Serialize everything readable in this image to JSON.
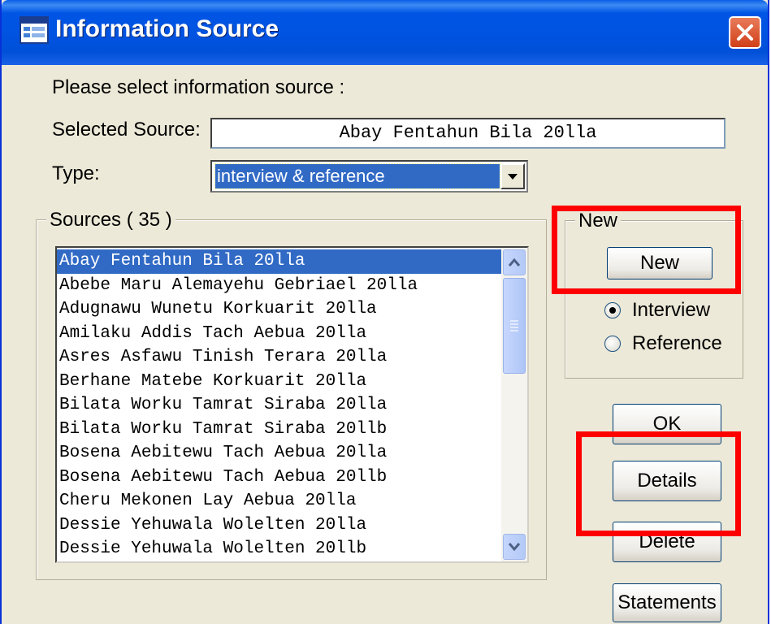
{
  "window": {
    "title": "Information Source"
  },
  "prompt": "Please select information source :",
  "selected_source": {
    "label": "Selected Source:",
    "value": "Abay Fentahun Bila 20lla"
  },
  "type": {
    "label": "Type:",
    "value": "interview & reference"
  },
  "sources": {
    "group_label": "Sources  ( 35 )",
    "items": [
      "Abay Fentahun Bila 20lla",
      "Abebe Maru Alemayehu Gebriael 20lla",
      "Adugnawu Wunetu Korkuarit 20lla",
      "Amilaku Addis Tach Aebua 20lla",
      "Asres Asfawu Tinish Terara 20lla",
      "Berhane Matebe Korkuarit 20lla",
      "Bilata Worku Tamrat Siraba 20lla",
      "Bilata Worku Tamrat Siraba 20llb",
      "Bosena Aebitewu Tach Aebua 20lla",
      "Bosena Aebitewu Tach Aebua 20llb",
      "Cheru Mekonen Lay Aebua 20lla",
      "Dessie Yehuwala Wolelten 20lla",
      "Dessie Yehuwala Wolelten 20llb"
    ],
    "selected_index": 0
  },
  "new_group": {
    "label": "New",
    "button_label": "New",
    "options": [
      "Interview",
      "Reference"
    ],
    "selected_option": "Interview"
  },
  "buttons": {
    "ok": "OK",
    "details": "Details",
    "delete": "Delete",
    "statements": "Statements"
  },
  "colors": {
    "titlebar": "#0054e3",
    "dialog_bg": "#ece9d8",
    "selection": "#316ac5",
    "highlight_box": "#ff0000"
  }
}
